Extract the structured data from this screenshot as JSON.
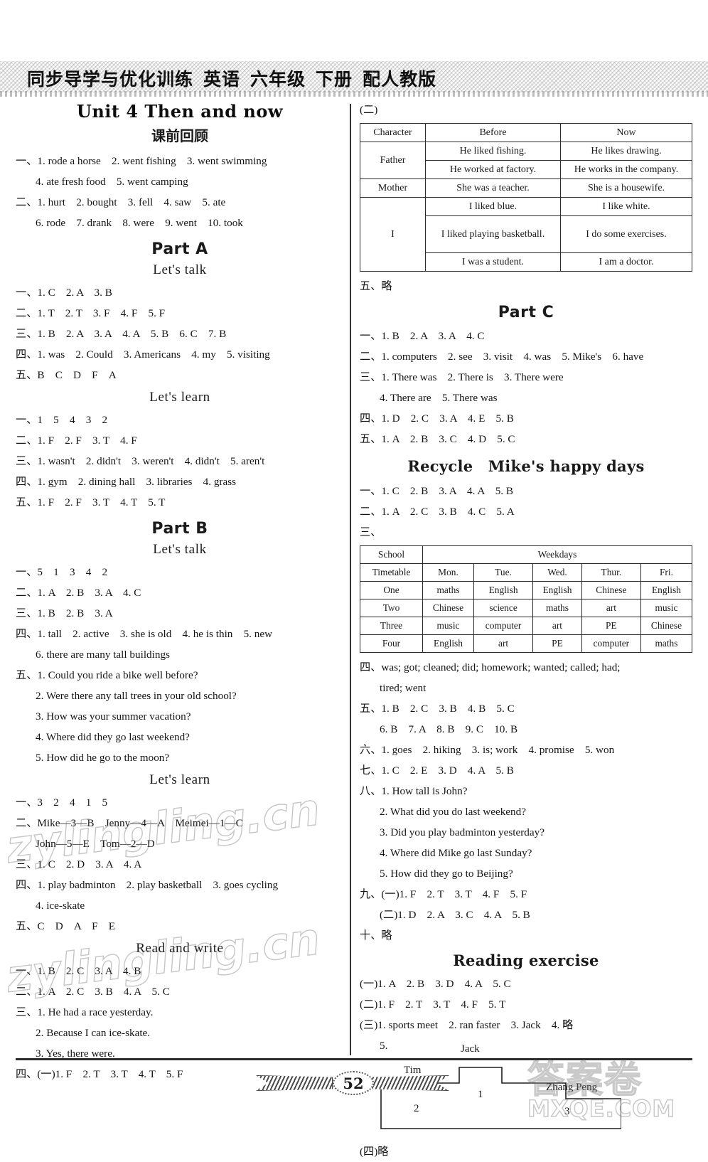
{
  "header": {
    "book_title": "同步导学与优化训练",
    "subject": "英语",
    "grade": "六年级",
    "volume": "下册",
    "edition": "配人教版"
  },
  "left_column": {
    "unit_title": "Unit 4 Then and now",
    "pre_review_heading": "课前回顾",
    "pre_review": [
      "一、1. rode a horse　2. went fishing　3. went swimming",
      "4. ate fresh food　5. went camping",
      "二、1. hurt　2. bought　3. fell　4. saw　5. ate",
      "6. rode　7. drank　8. were　9. went　10. took"
    ],
    "part_a": {
      "heading": "Part A",
      "lets_talk_heading": "Let's talk",
      "lets_talk": [
        "一、1. C　2. A　3. B",
        "二、1. T　2. T　3. F　4. F　5. F",
        "三、1. B　2. A　3. A　4. A　5. B　6. C　7. B",
        "四、1. was　2. Could　3. Americans　4. my　5. visiting",
        "五、B　C　D　F　A"
      ],
      "lets_learn_heading": "Let's learn",
      "lets_learn": [
        "一、1　5　4　3　2",
        "二、1. F　2. F　3. T　4. F",
        "三、1. wasn't　2. didn't　3. weren't　4. didn't　5. aren't",
        "四、1. gym　2. dining hall　3. libraries　4. grass",
        "五、1. F　2. F　3. T　4. T　5. T"
      ]
    },
    "part_b": {
      "heading": "Part B",
      "lets_talk_heading": "Let's talk",
      "lets_talk": [
        "一、5　1　3　4　2",
        "二、1. A　2. B　3. A　4. C",
        "三、1. B　2. B　3. A",
        "四、1. tall　2. active　3. she is old　4. he is thin　5. new",
        "6. there are many tall buildings",
        "五、1. Could you ride a bike well before?",
        "2. Were there any tall trees in your old school?",
        "3. How was your summer vacation?",
        "4. Where did they go last weekend?",
        "5. How did he go to the moon?"
      ],
      "lets_learn_heading": "Let's learn",
      "lets_learn": [
        "一、3　2　4　1　5",
        "二、Mike—3—B　Jenny—4—A　Meimei—1—C",
        "John—5—E　Tom—2—D",
        "三、1. C　2. D　3. A　4. A",
        "四、1. play badminton　2. play basketball　3. goes cycling",
        "4. ice-skate",
        "五、C　D　A　F　E"
      ],
      "read_and_write_heading": "Read and write",
      "read_and_write": [
        "一、1. B　2. C　3. A　4. B",
        "二、1. A　2. C　3. B　4. A　5. C",
        "三、1. He had a race yesterday.",
        "2. Because I can ice-skate.",
        "3. Yes, there were.",
        "四、(一)1. F　2. T　3. T　4. T　5. F"
      ]
    }
  },
  "right_column": {
    "section_two_label": "(二)",
    "character_table": {
      "headers": [
        "Character",
        "Before",
        "Now"
      ],
      "rows": [
        {
          "character": "Father",
          "rowspan": 2,
          "cells": [
            [
              "He liked fishing.",
              "He likes drawing."
            ],
            [
              "He worked at factory.",
              "He works in the company."
            ]
          ]
        },
        {
          "character": "Mother",
          "rowspan": 1,
          "cells": [
            [
              "She was a teacher.",
              "She is a housewife."
            ]
          ]
        },
        {
          "character": "I",
          "rowspan": 3,
          "cells": [
            [
              "I liked blue.",
              "I like white."
            ],
            [
              "I liked playing basketball.",
              "I do some exercises."
            ],
            [
              "I was a student.",
              "I am a doctor."
            ]
          ]
        }
      ]
    },
    "after_table_line": "五、略",
    "part_c": {
      "heading": "Part C",
      "lines": [
        "一、1. B　2. A　3. A　4. C",
        "二、1. computers　2. see　3. visit　4. was　5. Mike's　6. have",
        "三、1. There was　2. There is　3. There were",
        "4. There are　5. There was",
        "四、1. D　2. C　3. A　4. E　5. B",
        "五、1. A　2. B　3. C　4. D　5. C"
      ]
    },
    "recycle": {
      "heading": "Recycle　Mike's happy days",
      "lines_before_table": [
        "一、1. C　2. B　3. A　4. A　5. B",
        "二、1. A　2. C　3. B　4. C　5. A",
        "三、"
      ],
      "timetable": {
        "corner_line1": "School",
        "corner_line2": "Timetable",
        "weekdays_label": "Weekdays",
        "days": [
          "Mon.",
          "Tue.",
          "Wed.",
          "Thur.",
          "Fri."
        ],
        "rows": [
          {
            "label": "One",
            "subjects": [
              "maths",
              "English",
              "English",
              "Chinese",
              "English"
            ]
          },
          {
            "label": "Two",
            "subjects": [
              "Chinese",
              "science",
              "maths",
              "art",
              "music"
            ]
          },
          {
            "label": "Three",
            "subjects": [
              "music",
              "computer",
              "art",
              "PE",
              "Chinese"
            ]
          },
          {
            "label": "Four",
            "subjects": [
              "English",
              "art",
              "PE",
              "computer",
              "maths"
            ]
          }
        ]
      },
      "lines_after_table": [
        "四、was; got; cleaned; did; homework; wanted; called; had;",
        "tired; went",
        "五、1. B　2. C　3. B　4. B　5. C",
        "6. B　7. A　8. B　9. C　10. B",
        "六、1. goes　2. hiking　3. is; work　4. promise　5. won",
        "七、1. C　2. E　3. D　4. A　5. B",
        "八、1. How tall is John?",
        "2. What did you do last weekend?",
        "3. Did you play badminton yesterday?",
        "4. Where did Mike go last Sunday?",
        "5. How did they go to Beijing?",
        "九、(一)1. F　2. T　3. T　4. F　5. F",
        "(二)1. D　2. A　3. C　4. A　5. B",
        "十、略"
      ]
    },
    "reading_exercise": {
      "heading": "Reading exercise",
      "lines": [
        "(一)1. A　2. B　3. D　4. A　5. C",
        "(二)1. F　2. T　3. T　4. F　5. T",
        "(三)1. sports meet　2. ran faster　3. Jack　4. 略",
        "5."
      ],
      "podium": {
        "first_name": "Jack",
        "first_place": "1",
        "second_name": "Tim",
        "second_place": "2",
        "third_name": "Zhang Peng",
        "third_place": "3"
      },
      "final_line": "(四)略"
    }
  },
  "footer": {
    "page_number": "52"
  },
  "watermarks": {
    "site": "zylingling.cn",
    "brand_cn": "答案卷",
    "brand_en": "MXQE.COM"
  }
}
